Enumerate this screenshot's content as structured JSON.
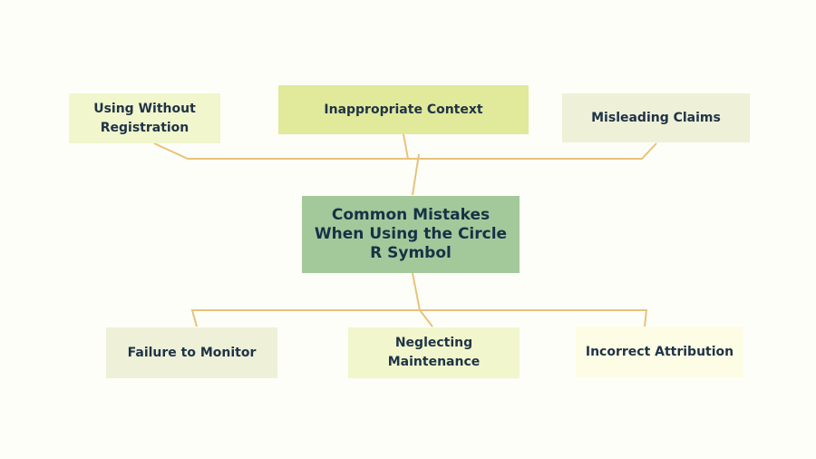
{
  "diagram": {
    "center": {
      "label": "Common Mistakes When Using the Circle R Symbol",
      "color": "#a3c99b"
    },
    "top_nodes": [
      {
        "label": "Using Without Registration",
        "color": "#f1f6cc"
      },
      {
        "label": "Inappropriate Context",
        "color": "#e1e99b"
      },
      {
        "label": "Misleading Claims",
        "color": "#eef0d8"
      }
    ],
    "bottom_nodes": [
      {
        "label": "Failure to Monitor",
        "color": "#eef0d8"
      },
      {
        "label": "Neglecting Maintenance",
        "color": "#f1f6cc"
      },
      {
        "label": "Incorrect Attribution",
        "color": "#fdfde6"
      }
    ],
    "connector_color": "#e8c27a"
  }
}
